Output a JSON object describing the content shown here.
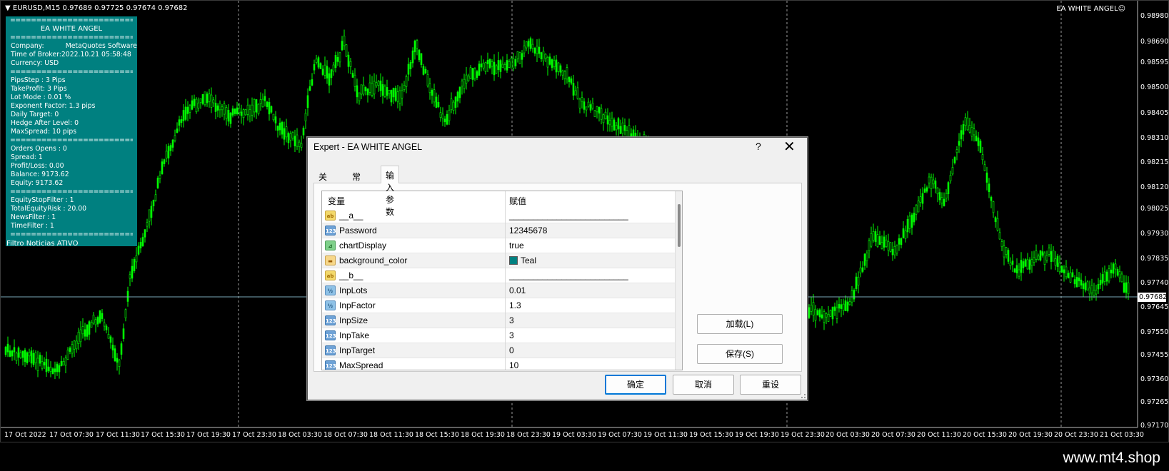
{
  "chart": {
    "header": "▼ EURUSD,M15  0.97689 0.97725 0.97674 0.97682",
    "ea_label": "EA WHITE ANGEL☺",
    "current_price": "0.97682",
    "price_labels": [
      "0.98980",
      "0.98690",
      "0.98595",
      "0.98500",
      "0.98405",
      "0.98310",
      "0.98215",
      "0.98120",
      "0.98025",
      "0.97930",
      "0.97835",
      "0.97740",
      "0.97645",
      "0.97550",
      "0.97455",
      "0.97360",
      "0.97265",
      "0.97170"
    ],
    "time_labels": [
      "17 Oct 2022",
      "17 Oct 07:30",
      "17 Oct 11:30",
      "17 Oct 15:30",
      "17 Oct 19:30",
      "17 Oct 23:30",
      "18 Oct 03:30",
      "18 Oct 07:30",
      "18 Oct 11:30",
      "18 Oct 15:30",
      "18 Oct 19:30",
      "18 Oct 23:30",
      "19 Oct 03:30",
      "19 Oct 07:30",
      "19 Oct 11:30",
      "19 Oct 15:30",
      "19 Oct 19:30",
      "19 Oct 23:30",
      "20 Oct 03:30",
      "20 Oct 07:30",
      "20 Oct 11:30",
      "20 Oct 15:30",
      "20 Oct 19:30",
      "20 Oct 23:30",
      "21 Oct 03:30"
    ],
    "candle_color": "#00ff00",
    "background": "#000000"
  },
  "info_panel": {
    "separator": "================================================",
    "title": "EA WHITE ANGEL",
    "company_label": "Company:",
    "company_value": "MetaQuotes Software Corp.",
    "time_of_broker": "Time of Broker:2022.10.21 05:58:48",
    "currency": "Currency: USD",
    "pips_step": "PipsStep : 3 Pips",
    "take_profit": "TakeProfit: 3 Pips",
    "lot_mode": "Lot Mode : 0.01 %",
    "exponent_factor": "Exponent Factor: 1.3 pips",
    "daily_target": "Daily Target: 0",
    "hedge_after_level": "Hedge After Level: 0",
    "max_spread": "MaxSpread: 10 pips",
    "orders_opens": "Orders Opens :    0",
    "spread": "Spread: 1",
    "profit_loss": "Profit/Loss: 0.00",
    "balance": "Balance:      9173.62",
    "equity": "Equity:       9173.62",
    "equity_stop_filter": "EquityStopFilter : 1",
    "total_equity_risk": "TotalEquityRisk : 20.00",
    "news_filter": "NewsFilter : 1",
    "time_filter": "TimeFilter : 1",
    "filtro": "Filtro Noticias ATIVO",
    "bg_color": "#008080"
  },
  "dialog": {
    "title": "Expert - EA WHITE ANGEL",
    "help": "?",
    "close": "✕",
    "tabs": [
      "关于",
      "常用",
      "输入参数"
    ],
    "active_tab": 2,
    "col_variable": "变量",
    "col_value": "赋值",
    "rows": [
      {
        "icon": "ab",
        "name": "__a__",
        "value": "_________________________"
      },
      {
        "icon": "123",
        "name": "Password",
        "value": "12345678"
      },
      {
        "icon": "bool",
        "name": "chartDisplay",
        "value": "true"
      },
      {
        "icon": "color",
        "name": "background_color",
        "value": "Teal"
      },
      {
        "icon": "ab",
        "name": "__b__",
        "value": "_________________________"
      },
      {
        "icon": "half",
        "name": "InpLots",
        "value": "0.01"
      },
      {
        "icon": "half",
        "name": "InpFactor",
        "value": "1.3"
      },
      {
        "icon": "123",
        "name": "InpSize",
        "value": "3"
      },
      {
        "icon": "123",
        "name": "InpTake",
        "value": "3"
      },
      {
        "icon": "123",
        "name": "InpTarget",
        "value": "0"
      },
      {
        "icon": "123",
        "name": "MaxSpread",
        "value": "10"
      }
    ],
    "load_button": "加载(L)",
    "save_button": "保存(S)",
    "ok_button": "确定",
    "cancel_button": "取消",
    "reset_button": "重设"
  },
  "watermark": "www.mt4.shop"
}
